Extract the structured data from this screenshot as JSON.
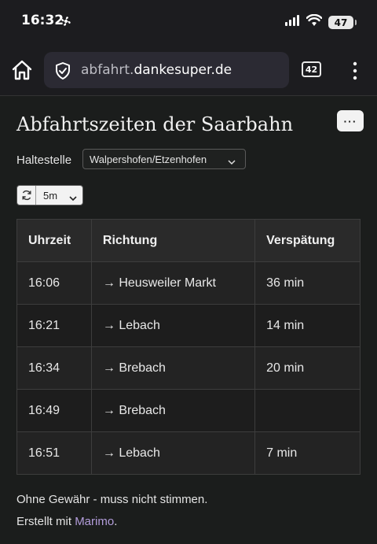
{
  "status_bar": {
    "time": "16:32",
    "battery": "47"
  },
  "browser": {
    "url_prefix": "abfahrt.",
    "url_domain": "dankesuper.de",
    "tab_count": "42"
  },
  "page": {
    "title": "Abfahrtszeiten der Saarbahn",
    "more_label": "···",
    "stop_label": "Haltestelle",
    "stop_selected": "Walpershofen/Etzenhofen",
    "interval_selected": "5m",
    "table": {
      "headers": [
        "Uhrzeit",
        "Richtung",
        "Verspätung"
      ],
      "rows": [
        {
          "time": "16:06",
          "direction": "→ Heusweiler Markt",
          "delay": "36 min"
        },
        {
          "time": "16:21",
          "direction": "→ Lebach",
          "delay": "14 min"
        },
        {
          "time": "16:34",
          "direction": "→ Brebach",
          "delay": "20 min"
        },
        {
          "time": "16:49",
          "direction": "→ Brebach",
          "delay": ""
        },
        {
          "time": "16:51",
          "direction": "→ Lebach",
          "delay": "7 min"
        }
      ]
    },
    "disclaimer": "Ohne Gewähr - muss nicht stimmen.",
    "created_prefix": "Erstellt mit ",
    "created_link": "Marimo",
    "created_suffix": "."
  },
  "colors": {
    "background": "#1b1d1c",
    "toolbar": "#1c1c1f",
    "link": "#b39ddb"
  }
}
